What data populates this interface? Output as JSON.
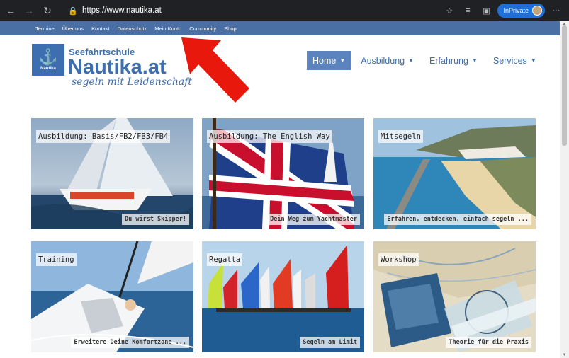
{
  "browser": {
    "url": "https://www.nautika.at",
    "inprivate_label": "InPrivate",
    "more_label": "···"
  },
  "topbar": {
    "links": [
      "Termine",
      "Über uns",
      "Kontakt",
      "Datenschutz",
      "Mein Konto",
      "Community",
      "Shop"
    ]
  },
  "logo": {
    "box_label": "Nautika",
    "top": "Seefahrtschule",
    "main": "Nautika.at",
    "sub": "segeln mit Leidenschaft"
  },
  "mainnav": [
    {
      "label": "Home"
    },
    {
      "label": "Ausbildung"
    },
    {
      "label": "Erfahrung"
    },
    {
      "label": "Services"
    }
  ],
  "tiles": [
    {
      "title": "Ausbildung: Basis/FB2/FB3/FB4",
      "caption": "Du wirst Skipper!"
    },
    {
      "title": "Ausbildung: The English Way",
      "caption": "Dein Weg zum Yachtmaster"
    },
    {
      "title": "Mitsegeln",
      "caption": "Erfahren, entdecken, einfach segeln ..."
    },
    {
      "title": "Training",
      "caption": "Erweitere Deine Komfortzone ..."
    },
    {
      "title": "Regatta",
      "caption": "Segeln am Limit"
    },
    {
      "title": "Workshop",
      "caption": "Theorie für die Praxis"
    }
  ],
  "colors": {
    "topbar": "#4a6fa5",
    "brand": "#3d6fb0",
    "nav_active": "#5b84bf",
    "arrow": "#e8180d"
  }
}
